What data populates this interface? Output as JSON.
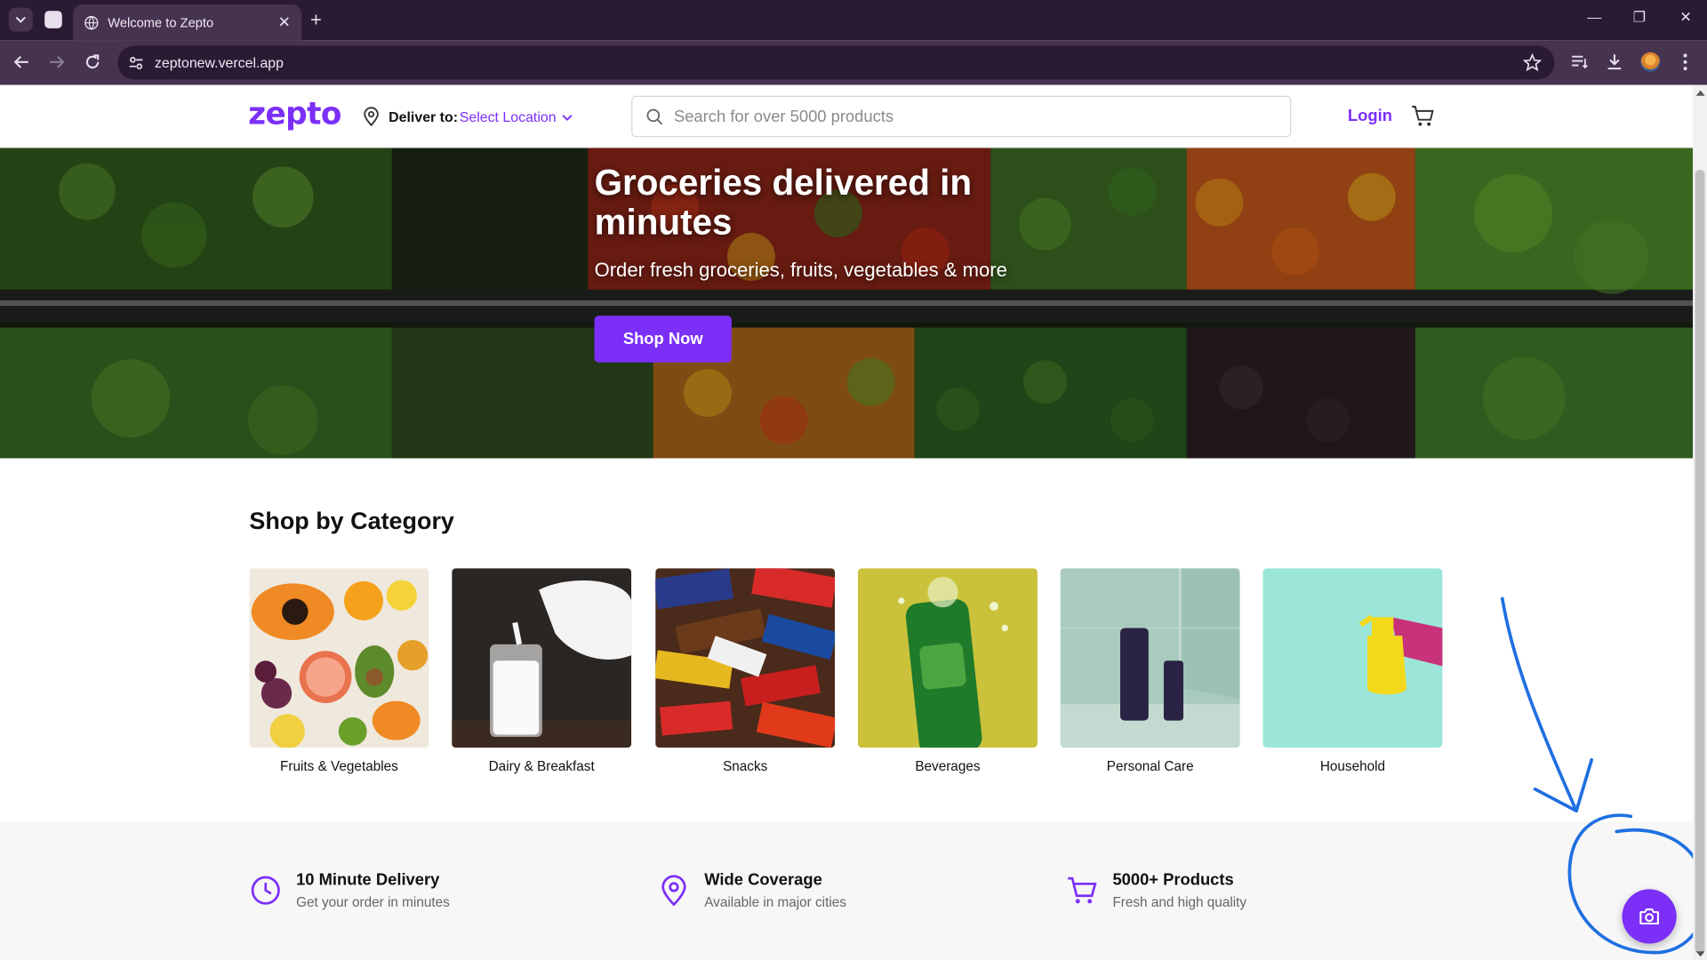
{
  "browser": {
    "tab_title": "Welcome to Zepto",
    "url": "zeptonew.vercel.app"
  },
  "header": {
    "logo": "zepto",
    "deliver_label": "Deliver to:",
    "location_label": "Select Location",
    "search_placeholder": "Search for over 5000 products",
    "login_label": "Login"
  },
  "hero": {
    "title": "Groceries delivered in minutes",
    "subtitle": "Order fresh groceries, fruits, vegetables & more",
    "cta": "Shop Now"
  },
  "categories": {
    "title": "Shop by Category",
    "items": [
      {
        "label": "Fruits & Vegetables"
      },
      {
        "label": "Dairy & Breakfast"
      },
      {
        "label": "Snacks"
      },
      {
        "label": "Beverages"
      },
      {
        "label": "Personal Care"
      },
      {
        "label": "Household"
      }
    ]
  },
  "features": [
    {
      "title": "10 Minute Delivery",
      "desc": "Get your order in minutes",
      "icon": "clock-icon"
    },
    {
      "title": "Wide Coverage",
      "desc": "Available in major cities",
      "icon": "map-pin-icon"
    },
    {
      "title": "5000+ Products",
      "desc": "Fresh and high quality",
      "icon": "cart-icon"
    }
  ],
  "colors": {
    "brand": "#7b2ff7",
    "chrome": "#2b1a33",
    "annotation": "#1f6fe0"
  }
}
